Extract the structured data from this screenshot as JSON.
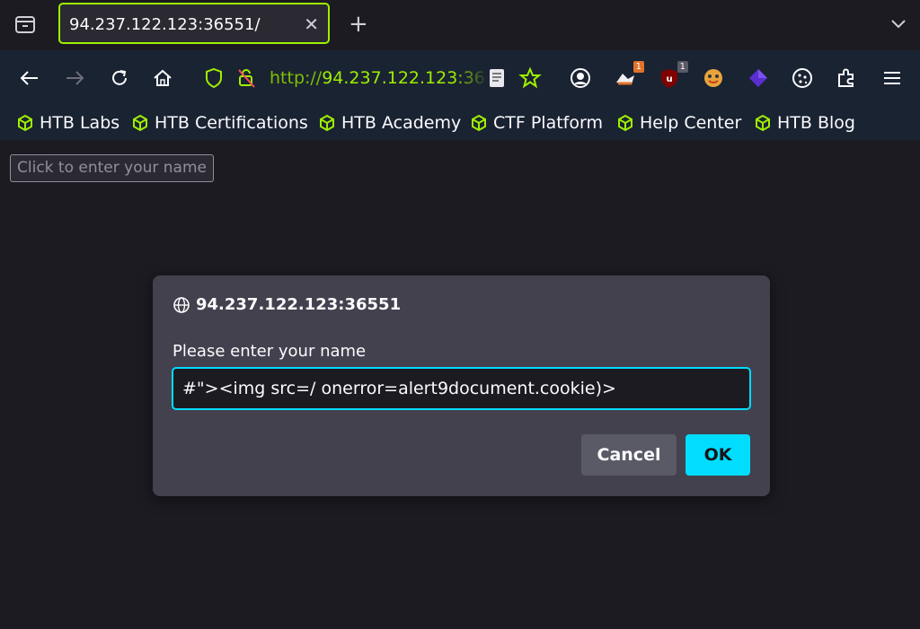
{
  "colors": {
    "accent_green": "#9fef00",
    "dialog_accent": "#00ddff",
    "background": "#1c1b22",
    "toolbar": "#1a2332",
    "dialog_bg": "#42414d"
  },
  "tabbar": {
    "tab_title": "94.237.122.123:36551/",
    "close_icon": "close-icon",
    "new_tab_symbol": "+"
  },
  "navbar": {
    "url_scheme": "http://",
    "url_host": "94.237.122.123:36",
    "icons": [
      "back-icon",
      "forward-icon",
      "reload-icon",
      "home-icon",
      "shield-icon",
      "insecure-lock-icon",
      "reader-icon",
      "bookmark-star-icon",
      "account-icon",
      "extension-icon",
      "ublock-icon",
      "extension-icon",
      "extension-icon",
      "cookie-icon",
      "extensions-puzzle-icon",
      "menu-icon"
    ],
    "badges": [
      "1",
      "1"
    ]
  },
  "bookmarks": [
    {
      "label": "HTB Labs"
    },
    {
      "label": "HTB Certifications"
    },
    {
      "label": "HTB Academy"
    },
    {
      "label": "CTF Platform"
    },
    {
      "label": "Help Center"
    },
    {
      "label": "HTB Blog"
    }
  ],
  "page": {
    "name_button": "Click to enter your name"
  },
  "dialog": {
    "origin": "94.237.122.123:36551",
    "message": "Please enter your name",
    "input_value": "#\"><img src=/ onerror=alert9document.cookie)>",
    "cancel_label": "Cancel",
    "ok_label": "OK"
  }
}
